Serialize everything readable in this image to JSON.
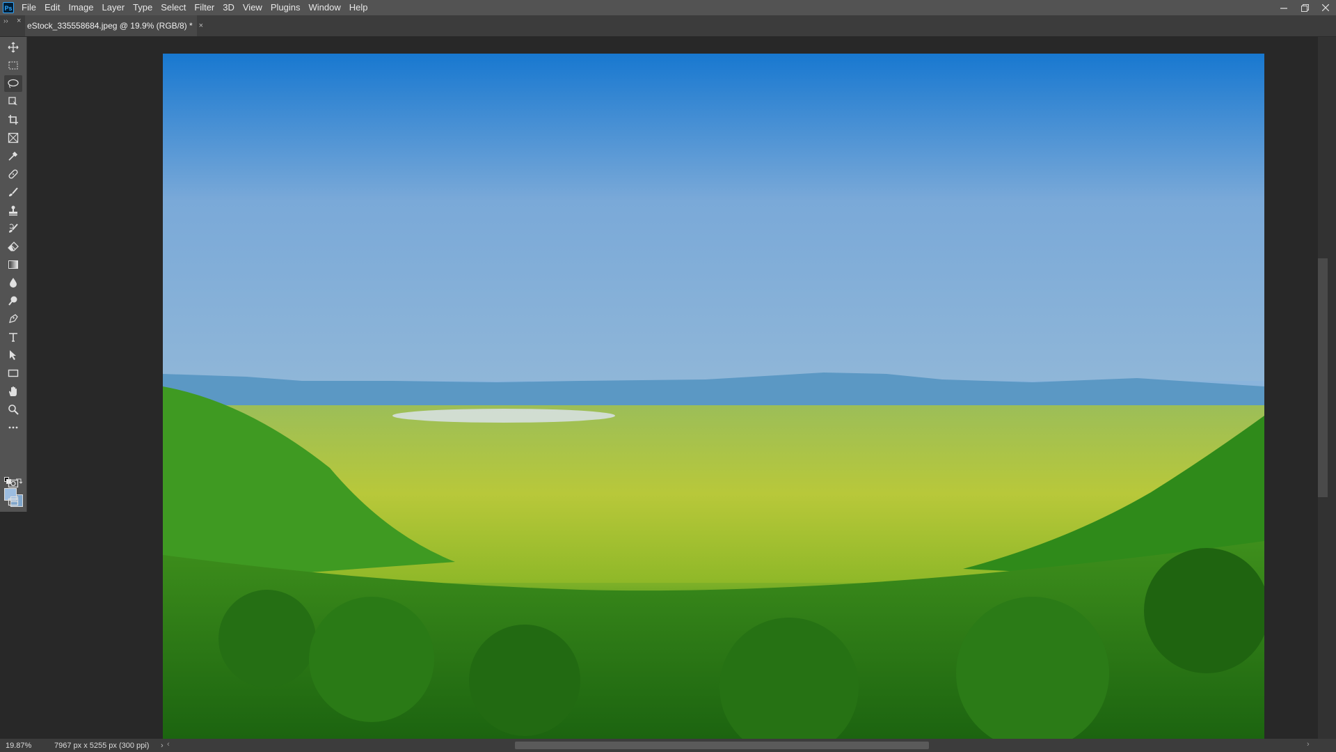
{
  "app": {
    "logo": "Ps"
  },
  "menu": [
    "File",
    "Edit",
    "Image",
    "Layer",
    "Type",
    "Select",
    "Filter",
    "3D",
    "View",
    "Plugins",
    "Window",
    "Help"
  ],
  "window_controls": [
    "minimize-icon",
    "restore-icon",
    "close-icon"
  ],
  "document_tab": {
    "title": "eStock_335558684.jpeg @ 19.9% (RGB/8) *",
    "close": "×"
  },
  "panel_controls": {
    "collapse": "››",
    "close": "×"
  },
  "tools": [
    "move-tool-icon",
    "marquee-tool-icon",
    "lasso-tool-icon",
    "object-select-tool-icon",
    "crop-tool-icon",
    "frame-tool-icon",
    "eyedropper-tool-icon",
    "healing-brush-tool-icon",
    "brush-tool-icon",
    "clone-stamp-tool-icon",
    "history-brush-tool-icon",
    "eraser-tool-icon",
    "gradient-tool-icon",
    "blur-tool-icon",
    "dodge-tool-icon",
    "pen-tool-icon",
    "type-tool-icon",
    "path-select-tool-icon",
    "rectangle-tool-icon",
    "hand-tool-icon",
    "zoom-tool-icon",
    "more-tools-icon",
    "quick-mask-icon",
    "screen-mode-icon"
  ],
  "colors": {
    "foreground": "#9cbde0",
    "background": "#7fa6cc"
  },
  "canvas": {
    "content": "landscape photo - crater valley under blue sky"
  },
  "status": {
    "zoom": "19.87%",
    "doc_info": "7967 px x 5255 px (300 ppi)",
    "arrow": "›"
  }
}
